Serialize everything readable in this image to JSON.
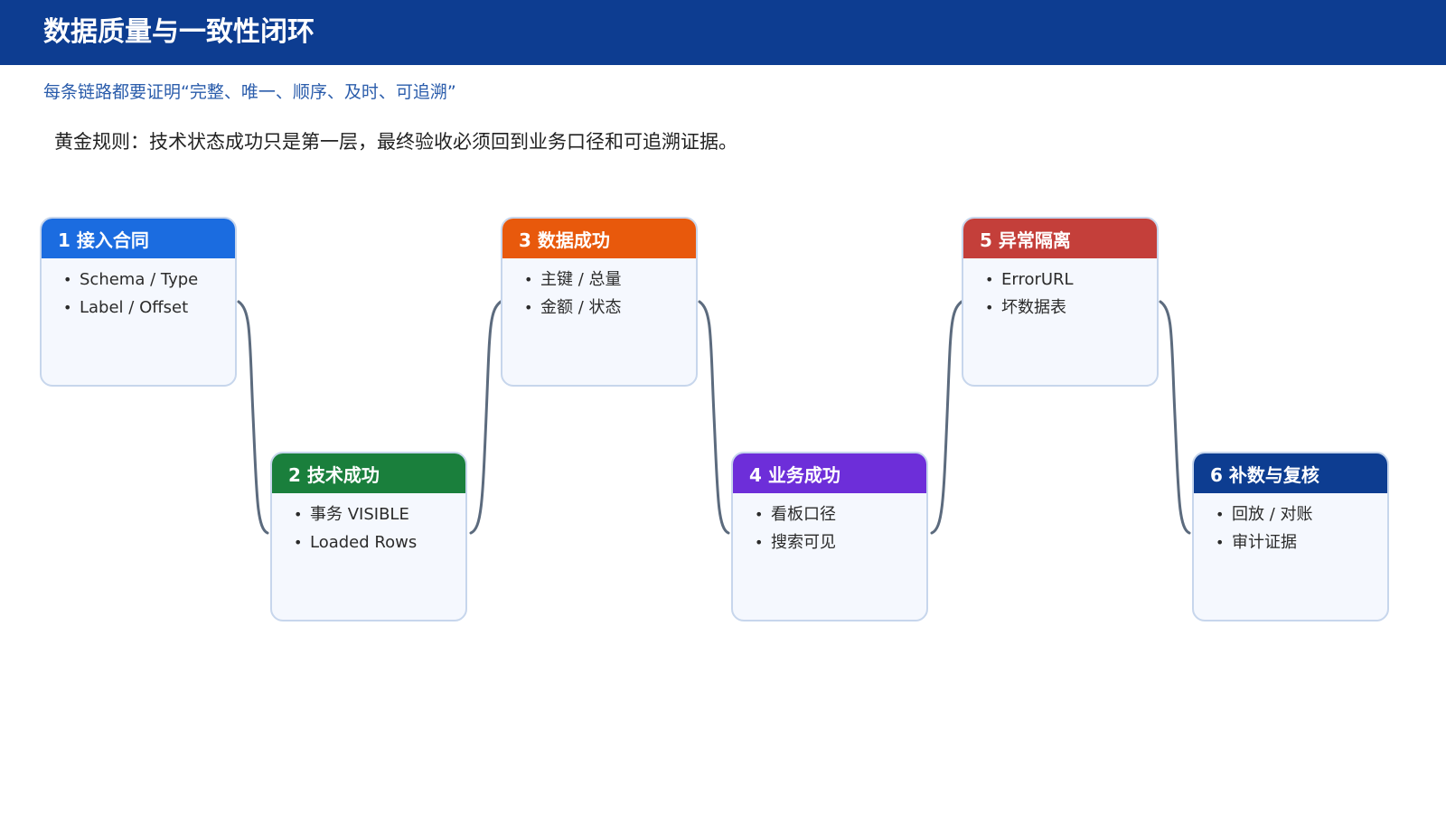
{
  "header": {
    "title": "数据质量与一致性闭环",
    "background": "#0d3d91"
  },
  "subtitle": "每条链路都要证明“完整、唯一、顺序、及时、可追溯”",
  "golden_rule": "黄金规则：技术状态成功只是第一层，最终验收必须回到业务口径和可追溯证据。",
  "steps": [
    {
      "title": "1 接入合同",
      "color": "#1b6ce0",
      "items": [
        "Schema / Type",
        "Label / Offset"
      ]
    },
    {
      "title": "2 技术成功",
      "color": "#1a7f3c",
      "items": [
        "事务 VISIBLE",
        "Loaded Rows"
      ]
    },
    {
      "title": "3 数据成功",
      "color": "#e8590c",
      "items": [
        "主键 / 总量",
        "金额 / 状态"
      ]
    },
    {
      "title": "4 业务成功",
      "color": "#6d2ed9",
      "items": [
        "看板口径",
        "搜索可见"
      ]
    },
    {
      "title": "5 异常隔离",
      "color": "#c43f3a",
      "items": [
        "ErrorURL",
        "坏数据表"
      ]
    },
    {
      "title": "6 补数与复核",
      "color": "#0d3d91",
      "items": [
        "回放 / 对账",
        "审计证据"
      ]
    }
  ]
}
